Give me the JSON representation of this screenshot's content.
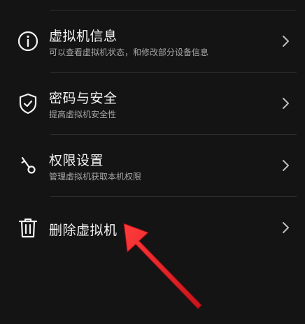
{
  "menu": {
    "items": [
      {
        "title": "虚拟机信息",
        "subtitle": "可以查看虚拟机状态，和修改部分设备信息",
        "icon": "info-icon"
      },
      {
        "title": "密码与安全",
        "subtitle": "提高虚拟机安全性",
        "icon": "shield-check-icon"
      },
      {
        "title": "权限设置",
        "subtitle": "管理虚拟机获取本机权限",
        "icon": "key-icon"
      },
      {
        "title": "删除虚拟机",
        "icon": "trash-icon"
      }
    ]
  },
  "colors": {
    "background": "#141414",
    "text_primary": "#f2f2f2",
    "text_secondary": "#a6a6a6",
    "divider": "#2e2e2e",
    "annotation_arrow": "#e0262b"
  }
}
